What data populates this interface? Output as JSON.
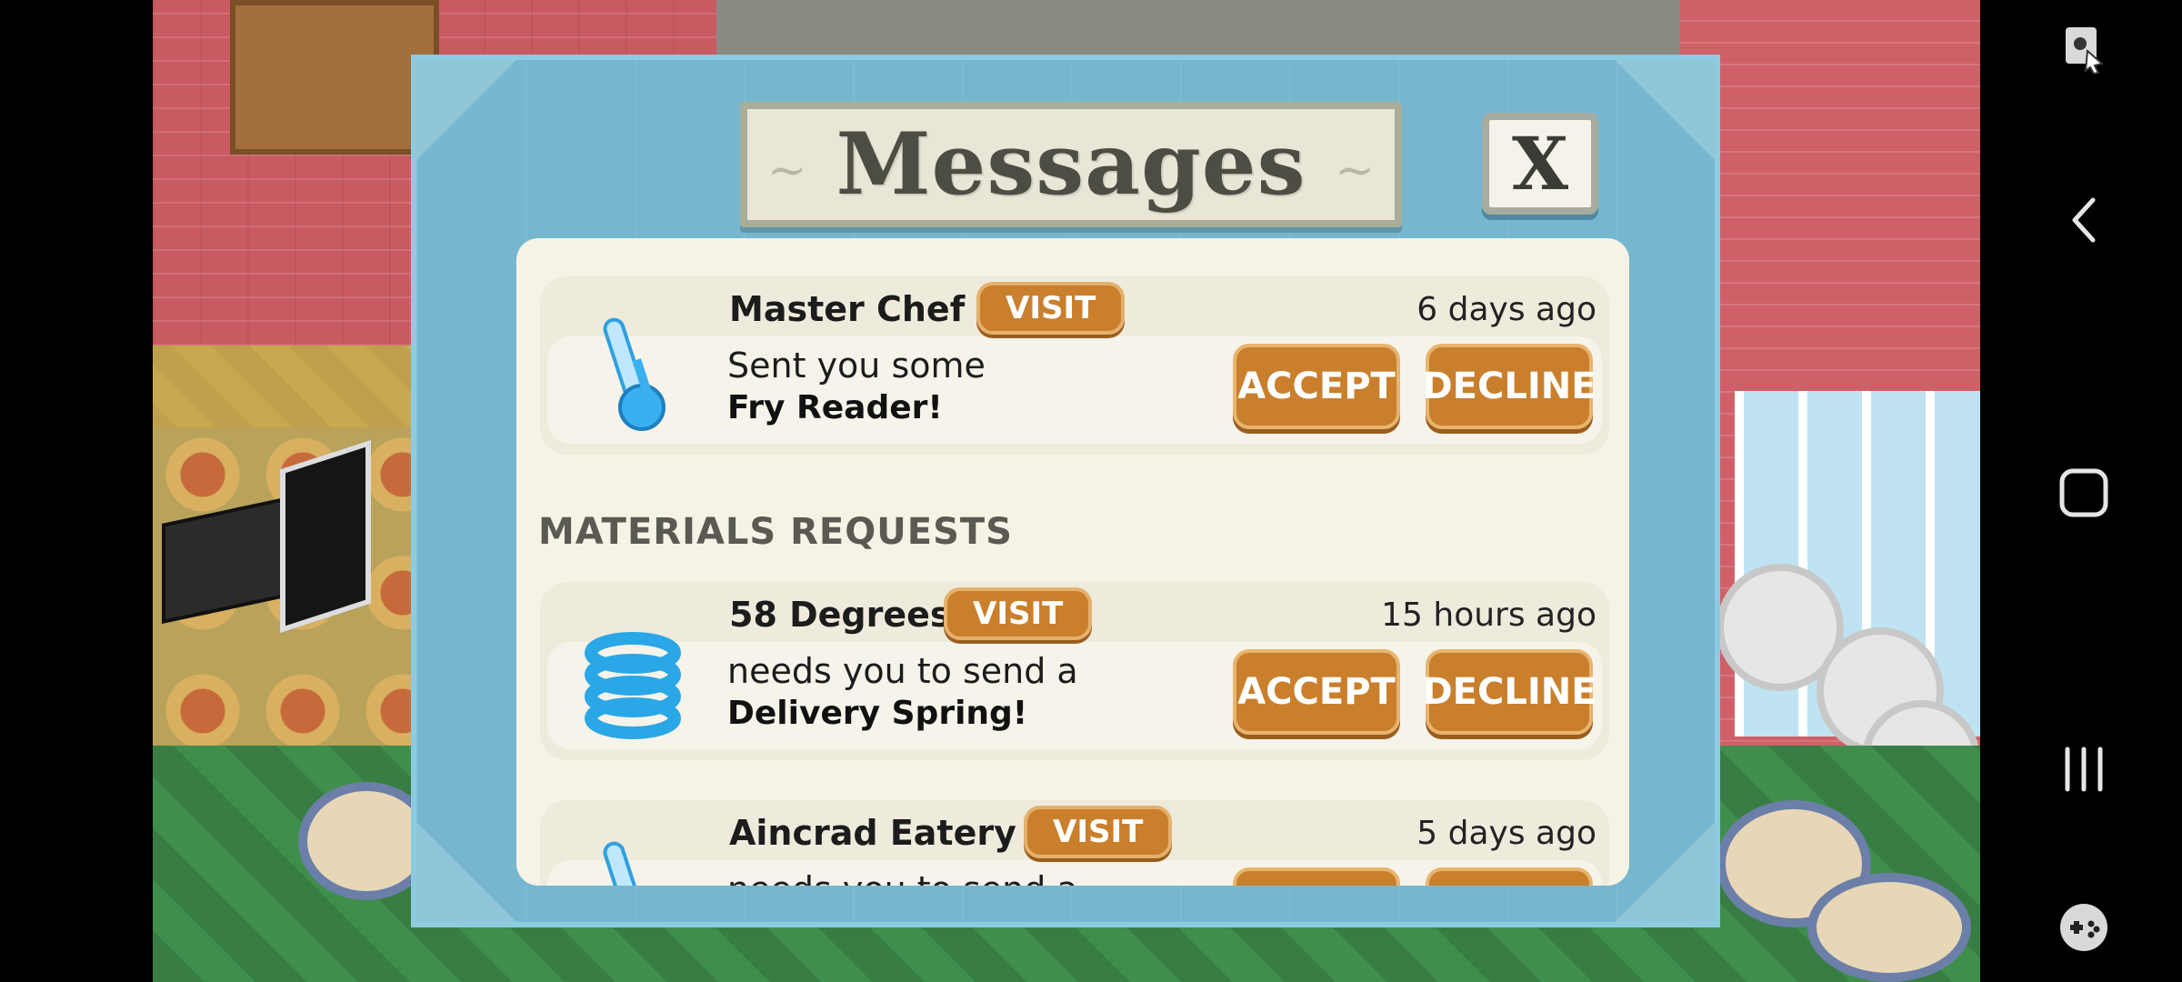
{
  "modal": {
    "title": "Messages",
    "close_label": "X",
    "section_title": "MATERIALS REQUESTS"
  },
  "messages": [
    {
      "sender": "Master Chef",
      "visit_label": "VISIT",
      "time": "6 days ago",
      "line1": "Sent you some",
      "line2": "Fry Reader!",
      "accept_label": "ACCEPT",
      "decline_label": "DECLINE",
      "icon": "thermometer-icon"
    },
    {
      "sender": "58 Degrees",
      "visit_label": "VISIT",
      "time": "15 hours ago",
      "line1": "needs you to send a",
      "line2": "Delivery Spring!",
      "accept_label": "ACCEPT",
      "decline_label": "DECLINE",
      "icon": "spring-icon"
    },
    {
      "sender": "Aincrad Eatery",
      "visit_label": "VISIT",
      "time": "5 days ago",
      "line1": "needs you to send a",
      "icon": "thermometer-icon"
    }
  ],
  "colors": {
    "button_orange": "#c97f2c",
    "modal_blue": "#76b7cf",
    "list_bg": "#f6f3e6"
  },
  "navbar": {
    "icons": [
      "screen-capture-icon",
      "back-icon",
      "home-icon",
      "recents-icon",
      "game-launcher-icon"
    ]
  }
}
